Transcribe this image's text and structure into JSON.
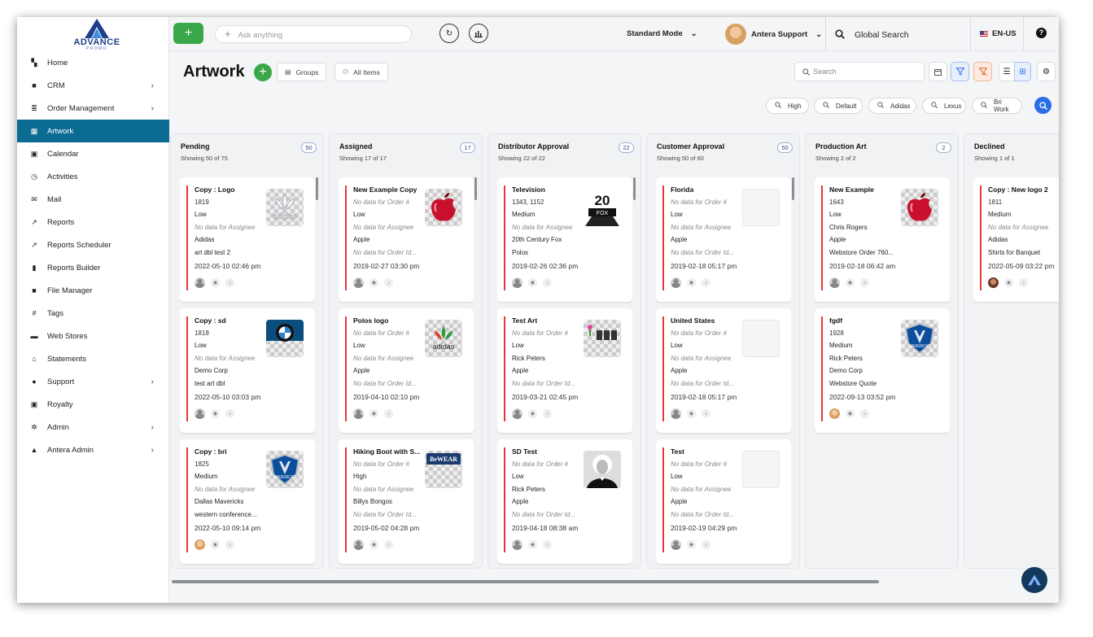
{
  "app": {
    "logo_main": "ADVANCE",
    "logo_sub": "PROMO"
  },
  "sidebar": {
    "items": [
      {
        "label": "Home",
        "icon": "dashboard-icon",
        "chevron": false,
        "active": false
      },
      {
        "label": "CRM",
        "icon": "briefcase-icon",
        "chevron": true,
        "active": false
      },
      {
        "label": "Order Management",
        "icon": "list-icon",
        "chevron": true,
        "active": false
      },
      {
        "label": "Artwork",
        "icon": "artwork-icon",
        "chevron": false,
        "active": true
      },
      {
        "label": "Calendar",
        "icon": "calendar-icon",
        "chevron": false,
        "active": false
      },
      {
        "label": "Activities",
        "icon": "clock-icon",
        "chevron": false,
        "active": false
      },
      {
        "label": "Mail",
        "icon": "envelope-icon",
        "chevron": false,
        "active": false
      },
      {
        "label": "Reports",
        "icon": "trend-icon",
        "chevron": false,
        "active": false
      },
      {
        "label": "Reports Scheduler",
        "icon": "trend-icon",
        "chevron": false,
        "active": false
      },
      {
        "label": "Reports Builder",
        "icon": "bar-chart-icon",
        "chevron": false,
        "active": false
      },
      {
        "label": "File Manager",
        "icon": "folder-icon",
        "chevron": false,
        "active": false
      },
      {
        "label": "Tags",
        "icon": "hash-icon",
        "chevron": false,
        "active": false
      },
      {
        "label": "Web Stores",
        "icon": "store-icon",
        "chevron": false,
        "active": false
      },
      {
        "label": "Statements",
        "icon": "bank-icon",
        "chevron": false,
        "active": false
      },
      {
        "label": "Support",
        "icon": "help-circle-icon",
        "chevron": true,
        "active": false
      },
      {
        "label": "Royalty",
        "icon": "calendar-icon",
        "chevron": false,
        "active": false
      },
      {
        "label": "Admin",
        "icon": "gear-icon",
        "chevron": true,
        "active": false
      },
      {
        "label": "Antera Admin",
        "icon": "lock-icon",
        "chevron": true,
        "active": false
      }
    ]
  },
  "topbar": {
    "ask_placeholder": "Ask anything",
    "mode": "Standard Mode",
    "user": "Antera Support",
    "global_search": "Global Search",
    "language": "EN-US"
  },
  "page": {
    "title": "Artwork",
    "groups_label": "Groups",
    "all_items_label": "All Items",
    "search_placeholder": "Search"
  },
  "chips": [
    "High",
    "Default",
    "Adidas",
    "Lexus",
    "Bri Work"
  ],
  "columns": [
    {
      "title": "Pending",
      "count": "50",
      "showing": "Showing 50 of 75",
      "cards": [
        {
          "name": "Copy : Logo",
          "number": "1819",
          "priority": "Low",
          "assignee": "No data for Assignee",
          "customer": "Adidas",
          "extra": "art dbl test 2",
          "date": "2022-05-10 02:46 pm",
          "thumb": "adidas",
          "avatar": "grey",
          "bell": false
        },
        {
          "name": "Copy : sd",
          "number": "1818",
          "priority": "Low",
          "assignee": "No data for Assignee",
          "customer": "Demo Corp",
          "extra": "test art dbl",
          "date": "2022-05-10 03:03 pm",
          "thumb": "bmw",
          "avatar": "grey",
          "bell": false
        },
        {
          "name": "Copy : bri",
          "number": "1825",
          "priority": "Medium",
          "assignee": "No data for Assignee",
          "customer": "Dallas Mavericks",
          "extra": "western conference...",
          "date": "2022-05-10 09:14 pm",
          "thumb": "mavs",
          "avatar": "face",
          "bell": false
        }
      ]
    },
    {
      "title": "Assigned",
      "count": "17",
      "showing": "Showing 17 of 17",
      "cards": [
        {
          "name": "New Example Copy",
          "number": "No data for Order #",
          "priority": "Low",
          "assignee": "No data for Assignee",
          "customer": "Apple",
          "extra": "No data for Order Id...",
          "date": "2019-02-27 03:30 pm",
          "thumb": "apple",
          "avatar": "grey",
          "bell": false
        },
        {
          "name": "Polos logo",
          "number": "No data for Order #",
          "priority": "Low",
          "assignee": "No data for Assignee",
          "customer": "Apple",
          "extra": "No data for Order Id...",
          "date": "2019-04-10 02:10 pm",
          "thumb": "adidas2",
          "avatar": "grey",
          "bell": false
        },
        {
          "name": "Hiking Boot with S...",
          "number": "No data for Order #",
          "priority": "High",
          "assignee": "No data for Assignee",
          "customer": "Billys Bongos",
          "extra": "No data for Order Id...",
          "date": "2019-05-02 04:28 pm",
          "thumb": "bwear",
          "avatar": "grey",
          "bell": false
        }
      ]
    },
    {
      "title": "Distributor Approval",
      "count": "22",
      "showing": "Showing 22 of 22",
      "cards": [
        {
          "name": "Television",
          "number": "1343, 1152",
          "priority": "Medium",
          "assignee": "No data for Assignee",
          "customer": "20th Century Fox",
          "extra": "Polos",
          "date": "2019-02-26 02:36 pm",
          "thumb": "fox",
          "avatar": "grey",
          "bell": false
        },
        {
          "name": "Test Art",
          "number": "No data for Order #",
          "priority": "Low",
          "assignee": "Rick Peters",
          "customer": "Apple",
          "extra": "No data for Order Id...",
          "date": "2019-03-21 02:45 pm",
          "thumb": "plant",
          "avatar": "grey",
          "bell": true
        },
        {
          "name": "SD Test",
          "number": "No data for Order #",
          "priority": "Low",
          "assignee": "Rick Peters",
          "customer": "Apple",
          "extra": "No data for Order Id...",
          "date": "2019-04-18 08:38 am",
          "thumb": "einstein",
          "avatar": "grey",
          "bell": false
        }
      ]
    },
    {
      "title": "Customer Approval",
      "count": "50",
      "showing": "Showing 50 of 60",
      "cards": [
        {
          "name": "Florida",
          "number": "No data for Order #",
          "priority": "Low",
          "assignee": "No data for Assignee",
          "customer": "Apple",
          "extra": "No data for Order Id...",
          "date": "2019-02-18 05:17 pm",
          "thumb": "empty",
          "avatar": "grey",
          "bell": false
        },
        {
          "name": "United States",
          "number": "No data for Order #",
          "priority": "Low",
          "assignee": "No data for Assignee",
          "customer": "Apple",
          "extra": "No data for Order Id...",
          "date": "2019-02-18 05:17 pm",
          "thumb": "empty",
          "avatar": "grey",
          "bell": false
        },
        {
          "name": "Test",
          "number": "No data for Order #",
          "priority": "Low",
          "assignee": "No data for Assignee",
          "customer": "Apple",
          "extra": "No data for Order Id...",
          "date": "2019-02-19 04:29 pm",
          "thumb": "empty",
          "avatar": "grey",
          "bell": false
        }
      ]
    },
    {
      "title": "Production Art",
      "count": "2",
      "showing": "Showing 2 of 2",
      "cards": [
        {
          "name": "New Example",
          "number": "1643",
          "priority": "Low",
          "assignee": "Chris Rogers",
          "customer": "Apple",
          "extra": "Webstore Order 760...",
          "date": "2019-02-18 06:42 am",
          "thumb": "apple",
          "avatar": "grey",
          "bell": false
        },
        {
          "name": "fgdf",
          "number": "1928",
          "priority": "Medium",
          "assignee": "Rick Peters",
          "customer": "Demo Corp",
          "extra": "Webstore Quote",
          "date": "2022-09-13 03:52 pm",
          "thumb": "mavs",
          "avatar": "face",
          "bell": false
        }
      ]
    },
    {
      "title": "Declined",
      "count": "",
      "showing": "Showing 1 of 1",
      "cards": [
        {
          "name": "Copy : New logo 2",
          "number": "1811",
          "priority": "Medium",
          "assignee": "No data for Assignee",
          "customer": "Adidas",
          "extra": "Shirts for Banquet",
          "date": "2022-05-09 03:22 pm",
          "thumb": "none",
          "avatar": "face2",
          "bell": true
        }
      ]
    }
  ],
  "colors": {
    "accent": "#0c6b93",
    "green": "#3aa84a",
    "red_bar": "#e53935",
    "blue": "#2a6fe8"
  }
}
